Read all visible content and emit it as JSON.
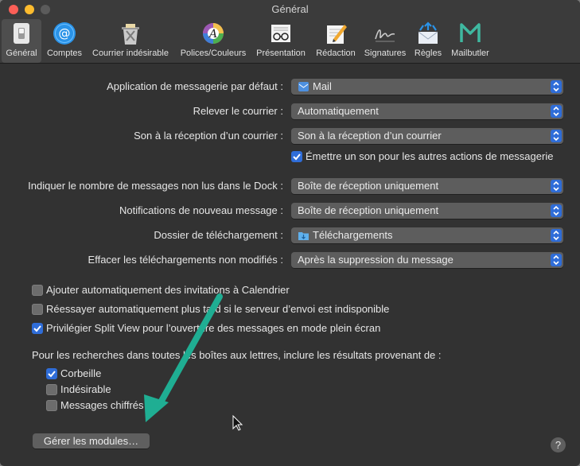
{
  "window": {
    "title": "Général"
  },
  "toolbar": {
    "items": [
      {
        "label": "Général",
        "icon": "switch-icon",
        "selected": true
      },
      {
        "label": "Comptes",
        "icon": "at-sign-icon"
      },
      {
        "label": "Courrier indésirable",
        "icon": "junk-bin-icon"
      },
      {
        "label": "Polices/Couleurs",
        "icon": "color-wheel-icon"
      },
      {
        "label": "Présentation",
        "icon": "glasses-icon"
      },
      {
        "label": "Rédaction",
        "icon": "pencil-paper-icon"
      },
      {
        "label": "Signatures",
        "icon": "signature-icon"
      },
      {
        "label": "Règles",
        "icon": "rules-envelope-icon"
      },
      {
        "label": "Mailbutler",
        "icon": "mailbutler-logo-icon"
      }
    ]
  },
  "settings": {
    "default_app": {
      "label": "Application de messagerie par défaut :",
      "value": "Mail",
      "icon": "mail-app-icon"
    },
    "check_mail": {
      "label": "Relever le courrier :",
      "value": "Automatiquement"
    },
    "new_mail_sound": {
      "label": "Son à la réception d’un courrier :",
      "value": "Son à la réception d’un courrier"
    },
    "other_sounds": {
      "label": "Émettre un son pour les autres actions de messagerie",
      "checked": true
    },
    "dock_unread": {
      "label": "Indiquer le nombre de messages non lus dans le Dock :",
      "value": "Boîte de réception uniquement"
    },
    "notifications": {
      "label": "Notifications de nouveau message :",
      "value": "Boîte de réception uniquement"
    },
    "downloads_folder": {
      "label": "Dossier de téléchargement :",
      "value": "Téléchargements",
      "icon": "downloads-folder-icon"
    },
    "remove_downloads": {
      "label": "Effacer les téléchargements non modifiés :",
      "value": "Après la suppression du message"
    }
  },
  "options": [
    {
      "label": "Ajouter automatiquement des invitations à Calendrier",
      "checked": false
    },
    {
      "label": "Réessayer automatiquement plus tard si le serveur d’envoi est indisponible",
      "checked": false
    },
    {
      "label": "Privilégier Split View pour l’ouverture des messages en mode plein écran",
      "checked": true
    }
  ],
  "search": {
    "label": "Pour les recherches dans toutes les boîtes aux lettres, inclure les résultats provenant de :",
    "items": [
      {
        "label": "Corbeille",
        "checked": true
      },
      {
        "label": "Indésirable",
        "checked": false
      },
      {
        "label": "Messages chiffrés",
        "checked": false
      }
    ]
  },
  "buttons": {
    "manage_plugins": "Gérer les modules…",
    "help": "?"
  },
  "colors": {
    "accent": "#2f6dd8",
    "annotation_arrow": "#1fae93"
  }
}
